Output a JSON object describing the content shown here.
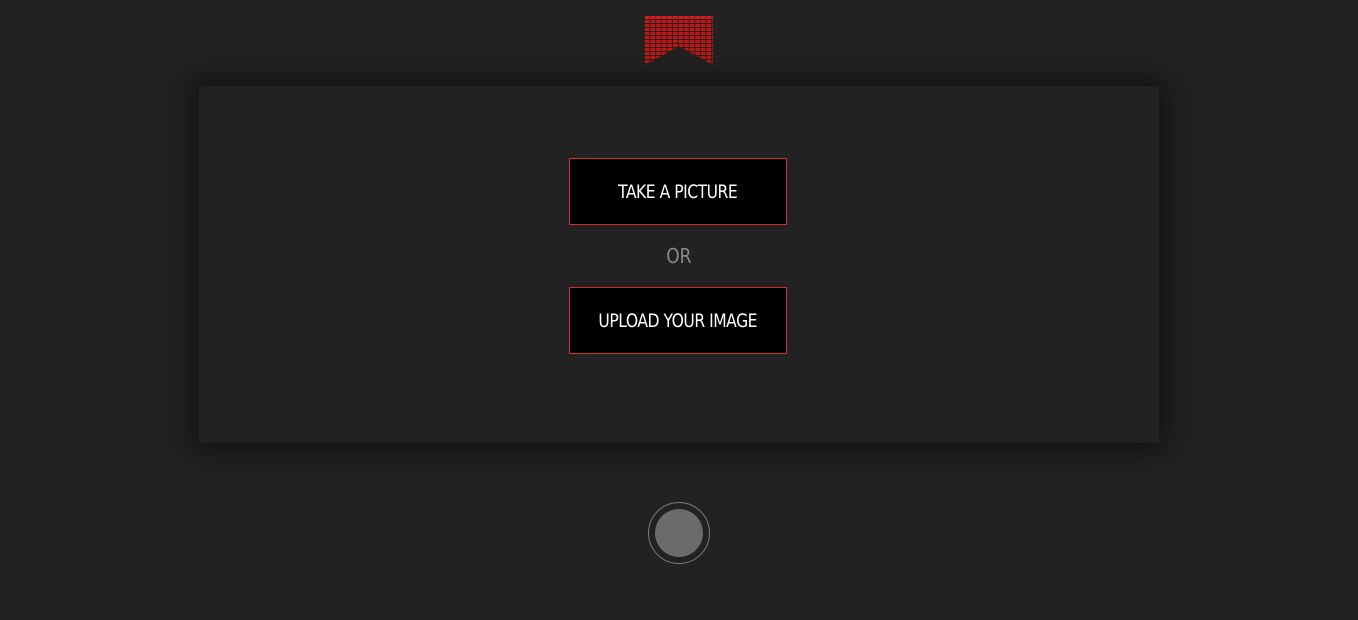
{
  "brand": {
    "logo_icon": "red-bars-logo-icon",
    "accent_color": "#d8262b"
  },
  "actions": {
    "take_picture_label": "TAKE A PICTURE",
    "separator_label": "OR",
    "upload_image_label": "UPLOAD YOUR IMAGE"
  },
  "capture": {
    "icon": "shutter-button-icon"
  }
}
